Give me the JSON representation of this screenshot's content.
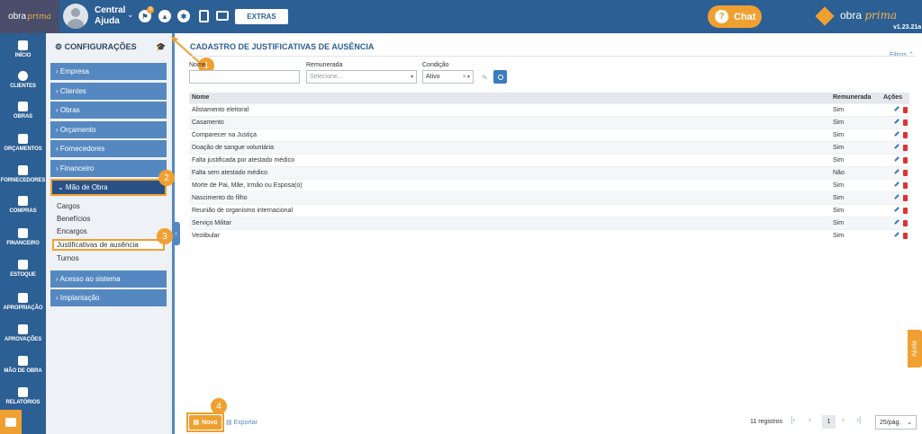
{
  "app": {
    "logo_text": "obra",
    "logo_accent": "prima",
    "user_name": "Central Ajuda",
    "notif_count": "9",
    "extras_label": "EXTRAS",
    "chat_label": "Chat",
    "brand_name": "obra",
    "brand_accent": "prima",
    "version": "v1.23.21a",
    "ajuda_label": "Ajuda"
  },
  "leftnav": [
    {
      "label": "INÍCIO",
      "icon": "home-icon"
    },
    {
      "label": "CLIENTES",
      "icon": "person-icon"
    },
    {
      "label": "OBRAS",
      "icon": "building-icon"
    },
    {
      "label": "ORÇAMENTOS",
      "icon": "document-icon"
    },
    {
      "label": "FORNECEDORES",
      "icon": "truck-icon"
    },
    {
      "label": "COMPRAS",
      "icon": "cart-icon"
    },
    {
      "label": "FINANCEIRO",
      "icon": "calculator-icon"
    },
    {
      "label": "ESTOQUE",
      "icon": "boxes-icon"
    },
    {
      "label": "APROPRIAÇÃO",
      "icon": "file-icon"
    },
    {
      "label": "APROVAÇÕES",
      "icon": "checklist-icon"
    },
    {
      "label": "MÃO DE OBRA",
      "icon": "workers-icon"
    },
    {
      "label": "RELATÓRIOS",
      "icon": "report-icon"
    }
  ],
  "config": {
    "title": "CONFIGURAÇÕES",
    "items": [
      {
        "label": "› Empresa"
      },
      {
        "label": "› Clientes"
      },
      {
        "label": "› Obras"
      },
      {
        "label": "› Orçamento"
      },
      {
        "label": "› Fornecedores"
      },
      {
        "label": "› Financeiro"
      },
      {
        "label": "⌄ Mão de Obra"
      },
      {
        "label": "› Acesso ao sistema"
      },
      {
        "label": "› Implantação"
      }
    ],
    "subitems": [
      {
        "label": "Cargos"
      },
      {
        "label": "Benefícios"
      },
      {
        "label": "Encargos"
      },
      {
        "label": "Justificativas de ausência"
      },
      {
        "label": "Turnos"
      }
    ]
  },
  "callouts": [
    "1",
    "2",
    "3",
    "4"
  ],
  "main": {
    "title": "CADASTRO DE JUSTIFICATIVAS DE AUSÊNCIA",
    "filtros": "Filtros ⌃",
    "filters": {
      "nome_label": "Nome",
      "remunerada_label": "Remunerada",
      "remunerada_placeholder": "Selecione...",
      "condicao_label": "Condição",
      "condicao_value": "Ativo"
    },
    "columns": [
      "Nome",
      "Remunerada",
      "Ações"
    ],
    "rows": [
      {
        "nome": "Alistamento eleitoral",
        "remunerada": "Sim"
      },
      {
        "nome": "Casamento",
        "remunerada": "Sim"
      },
      {
        "nome": "Comparecer na Justiça",
        "remunerada": "Sim"
      },
      {
        "nome": "Doação de sangue voluntária",
        "remunerada": "Sim"
      },
      {
        "nome": "Falta justificada por atestado médico",
        "remunerada": "Sim"
      },
      {
        "nome": "Falta sem atestado médico",
        "remunerada": "Não"
      },
      {
        "nome": "Morte de Pai, Mãe, Irmão ou Esposa(o)",
        "remunerada": "Sim"
      },
      {
        "nome": "Nascimento do filho",
        "remunerada": "Sim"
      },
      {
        "nome": "Reunião de organismo internacional",
        "remunerada": "Sim"
      },
      {
        "nome": "Serviço Militar",
        "remunerada": "Sim"
      },
      {
        "nome": "Vestibular",
        "remunerada": "Sim"
      }
    ]
  },
  "footer": {
    "novo_label": "Novo",
    "export_label": "Exportar",
    "registros": "11 registros",
    "current_page": "1",
    "per_page": "25/pág."
  },
  "colors": {
    "primary": "#2c5f93",
    "accent": "#f0a030",
    "sidebar_item": "#5588c0"
  }
}
